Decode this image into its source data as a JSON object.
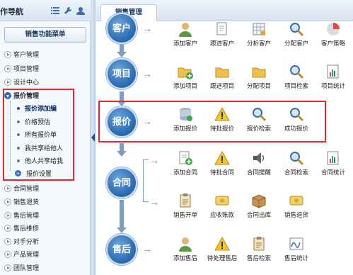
{
  "sidebar": {
    "title": "作导航",
    "menu_button": "销售功能菜单",
    "items": [
      {
        "label": "客户管理"
      },
      {
        "label": "项目管理"
      },
      {
        "label": "设计中心"
      },
      {
        "label": "报价管理"
      },
      {
        "label": "合同管理"
      },
      {
        "label": "销售退货"
      },
      {
        "label": "售后管理"
      },
      {
        "label": "售后维修"
      },
      {
        "label": "对手分析"
      },
      {
        "label": "产品管理"
      },
      {
        "label": "团队管理"
      }
    ],
    "subitems": [
      {
        "label": "报价添加编"
      },
      {
        "label": "价格预估"
      },
      {
        "label": "所有报价单"
      },
      {
        "label": "我共享给他人"
      },
      {
        "label": "他人共享给我"
      },
      {
        "label": "报价设置"
      }
    ]
  },
  "tab": {
    "label": "销售管理"
  },
  "flow": {
    "customer": {
      "title": "客户",
      "actions": [
        "添加客户",
        "跟进客户",
        "分析客户",
        "分配客户",
        "客户策略"
      ]
    },
    "project": {
      "title": "项目",
      "actions": [
        "添加项目",
        "跟进项目",
        "分配项目",
        "项目检索",
        "项目统计"
      ]
    },
    "quote": {
      "title": "报价",
      "actions": [
        "添加报价",
        "待批报价",
        "报价检索",
        "成功报价"
      ]
    },
    "contract": {
      "title": "合同",
      "actions": [
        "添加合同",
        "待批合同",
        "合同提醒",
        "合同检索",
        "合同统计",
        "销售开单",
        "应收账款",
        "合同出库",
        "销售退货"
      ]
    },
    "aftersale": {
      "title": "售后",
      "actions": [
        "添加售后",
        "待处理售后",
        "售后检索",
        "售后统计"
      ]
    }
  }
}
